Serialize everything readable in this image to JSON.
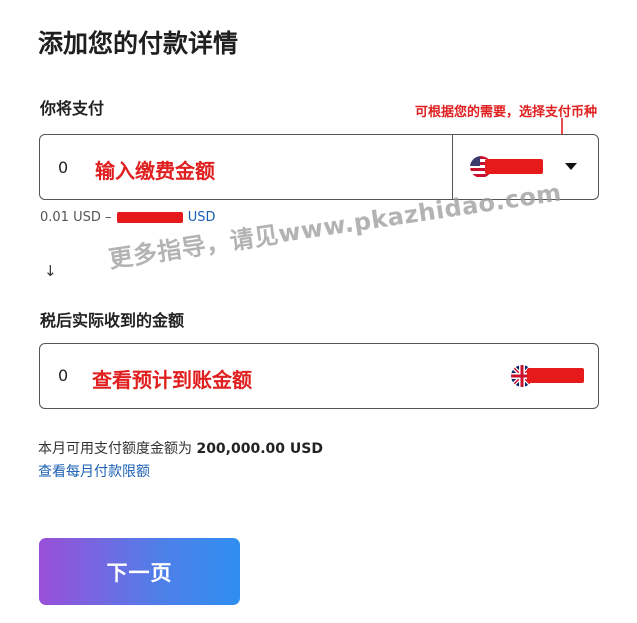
{
  "page": {
    "title": "添加您的付款详情",
    "watermark": "更多指导，请见www.pkazhidao.com"
  },
  "pay": {
    "label": "你将支付",
    "amount": "0",
    "annotation": "输入缴费金额",
    "currency_hint": "可根据您的需要，选择支付币种",
    "range_min": "0.01 USD –",
    "range_currency": "USD"
  },
  "receive": {
    "label": "税后实际收到的金额",
    "amount": "0",
    "annotation": "查看预计到账金额"
  },
  "limit": {
    "text_prefix": "本月可用支付额度金额为",
    "amount": "200,000.00 USD",
    "link": "查看每月付款限额"
  },
  "actions": {
    "next_label": "下一页"
  },
  "colors": {
    "annotation_red": "#e02020",
    "link_blue": "#1a5fb4",
    "button_gradient_start": "#9a4fd8",
    "button_gradient_end": "#2f8ef0"
  },
  "icons": {
    "pay_flag": "us-flag-icon",
    "receive_flag": "uk-flag-icon",
    "dropdown": "caret-down-icon",
    "separator": "down-arrow-icon"
  }
}
